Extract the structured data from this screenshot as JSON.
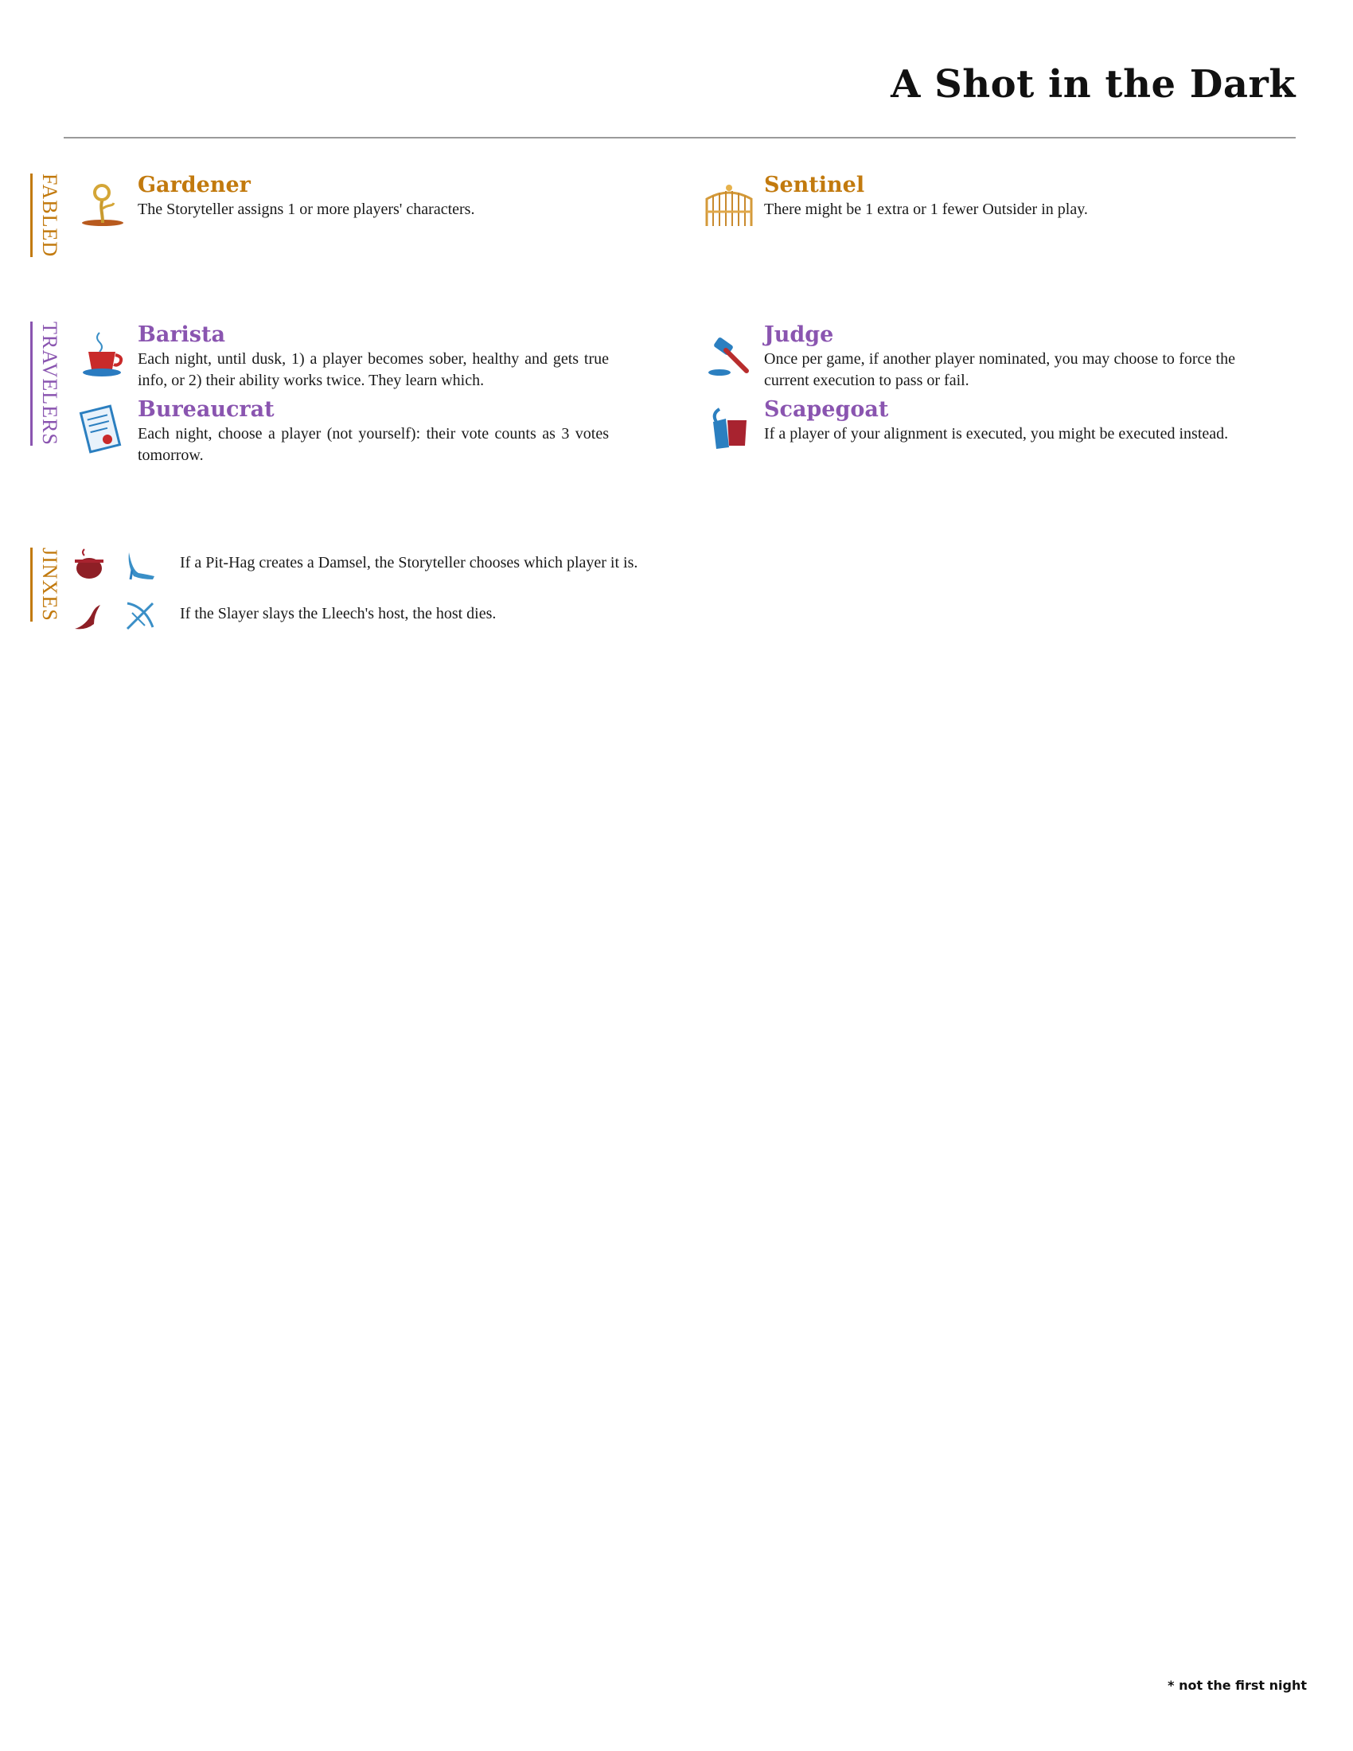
{
  "page": {
    "title": "A Shot in the Dark",
    "footnote": "* not the first night"
  },
  "fabled": {
    "label": "FABLED",
    "characters": [
      {
        "name": "Gardener",
        "ability": "The Storyteller assigns 1 or more players' characters.",
        "icon": "sprout-icon"
      },
      {
        "name": "Sentinel",
        "ability": "There might be 1 extra or 1 fewer Outsider in play.",
        "icon": "gate-icon"
      }
    ]
  },
  "travelers": {
    "label": "TRAVELERS",
    "characters": [
      {
        "name": "Barista",
        "ability": "Each night, until dusk, 1) a player becomes sober, healthy and gets true info, or 2) their ability works twice. They learn which.",
        "icon": "coffee-cup-icon"
      },
      {
        "name": "Judge",
        "ability": "Once per game, if another player nominated, you may choose to force the current execution to pass or fail.",
        "icon": "gavel-icon"
      },
      {
        "name": "Bureaucrat",
        "ability": "Each night, choose a player (not yourself): their vote counts as 3 votes tomorrow.",
        "icon": "document-icon"
      },
      {
        "name": "Scapegoat",
        "ability": "If a player of your alignment is executed, you might be executed instead.",
        "icon": "goat-icon"
      }
    ]
  },
  "jinxes": {
    "label": "JINXES",
    "items": [
      {
        "text": "If a Pit-Hag creates a Damsel, the Storyteller chooses which player it is.",
        "icon_a": "cauldron-icon",
        "icon_b": "slipper-icon"
      },
      {
        "text": "If the Slayer slays the Lleech's host, the host dies.",
        "icon_a": "leech-icon",
        "icon_b": "crossbow-icon"
      }
    ]
  }
}
